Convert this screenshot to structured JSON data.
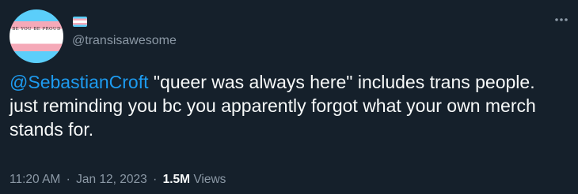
{
  "tweet": {
    "avatar": {
      "text": "BE YOU BE PROUD"
    },
    "author": {
      "display_name_icon": "transgender-flag-emoji",
      "handle": "@transisawesome"
    },
    "text": {
      "mention": "@SebastianCroft",
      "body": " \"queer was always here\" includes trans people. just reminding you bc you apparently forgot what your own merch stands for."
    },
    "meta": {
      "time": "11:20 AM",
      "separator": "·",
      "date": "Jan 12, 2023",
      "views_count": "1.5M",
      "views_label": "Views"
    },
    "more_icon": "more-horizontal-icon"
  },
  "colors": {
    "background": "#15202b",
    "text_primary": "#f7f9f9",
    "text_secondary": "#8b98a5",
    "link": "#1d9bf0",
    "trans_blue": "#5bcefa",
    "trans_pink": "#f5a9b8",
    "trans_white": "#ffffff"
  }
}
